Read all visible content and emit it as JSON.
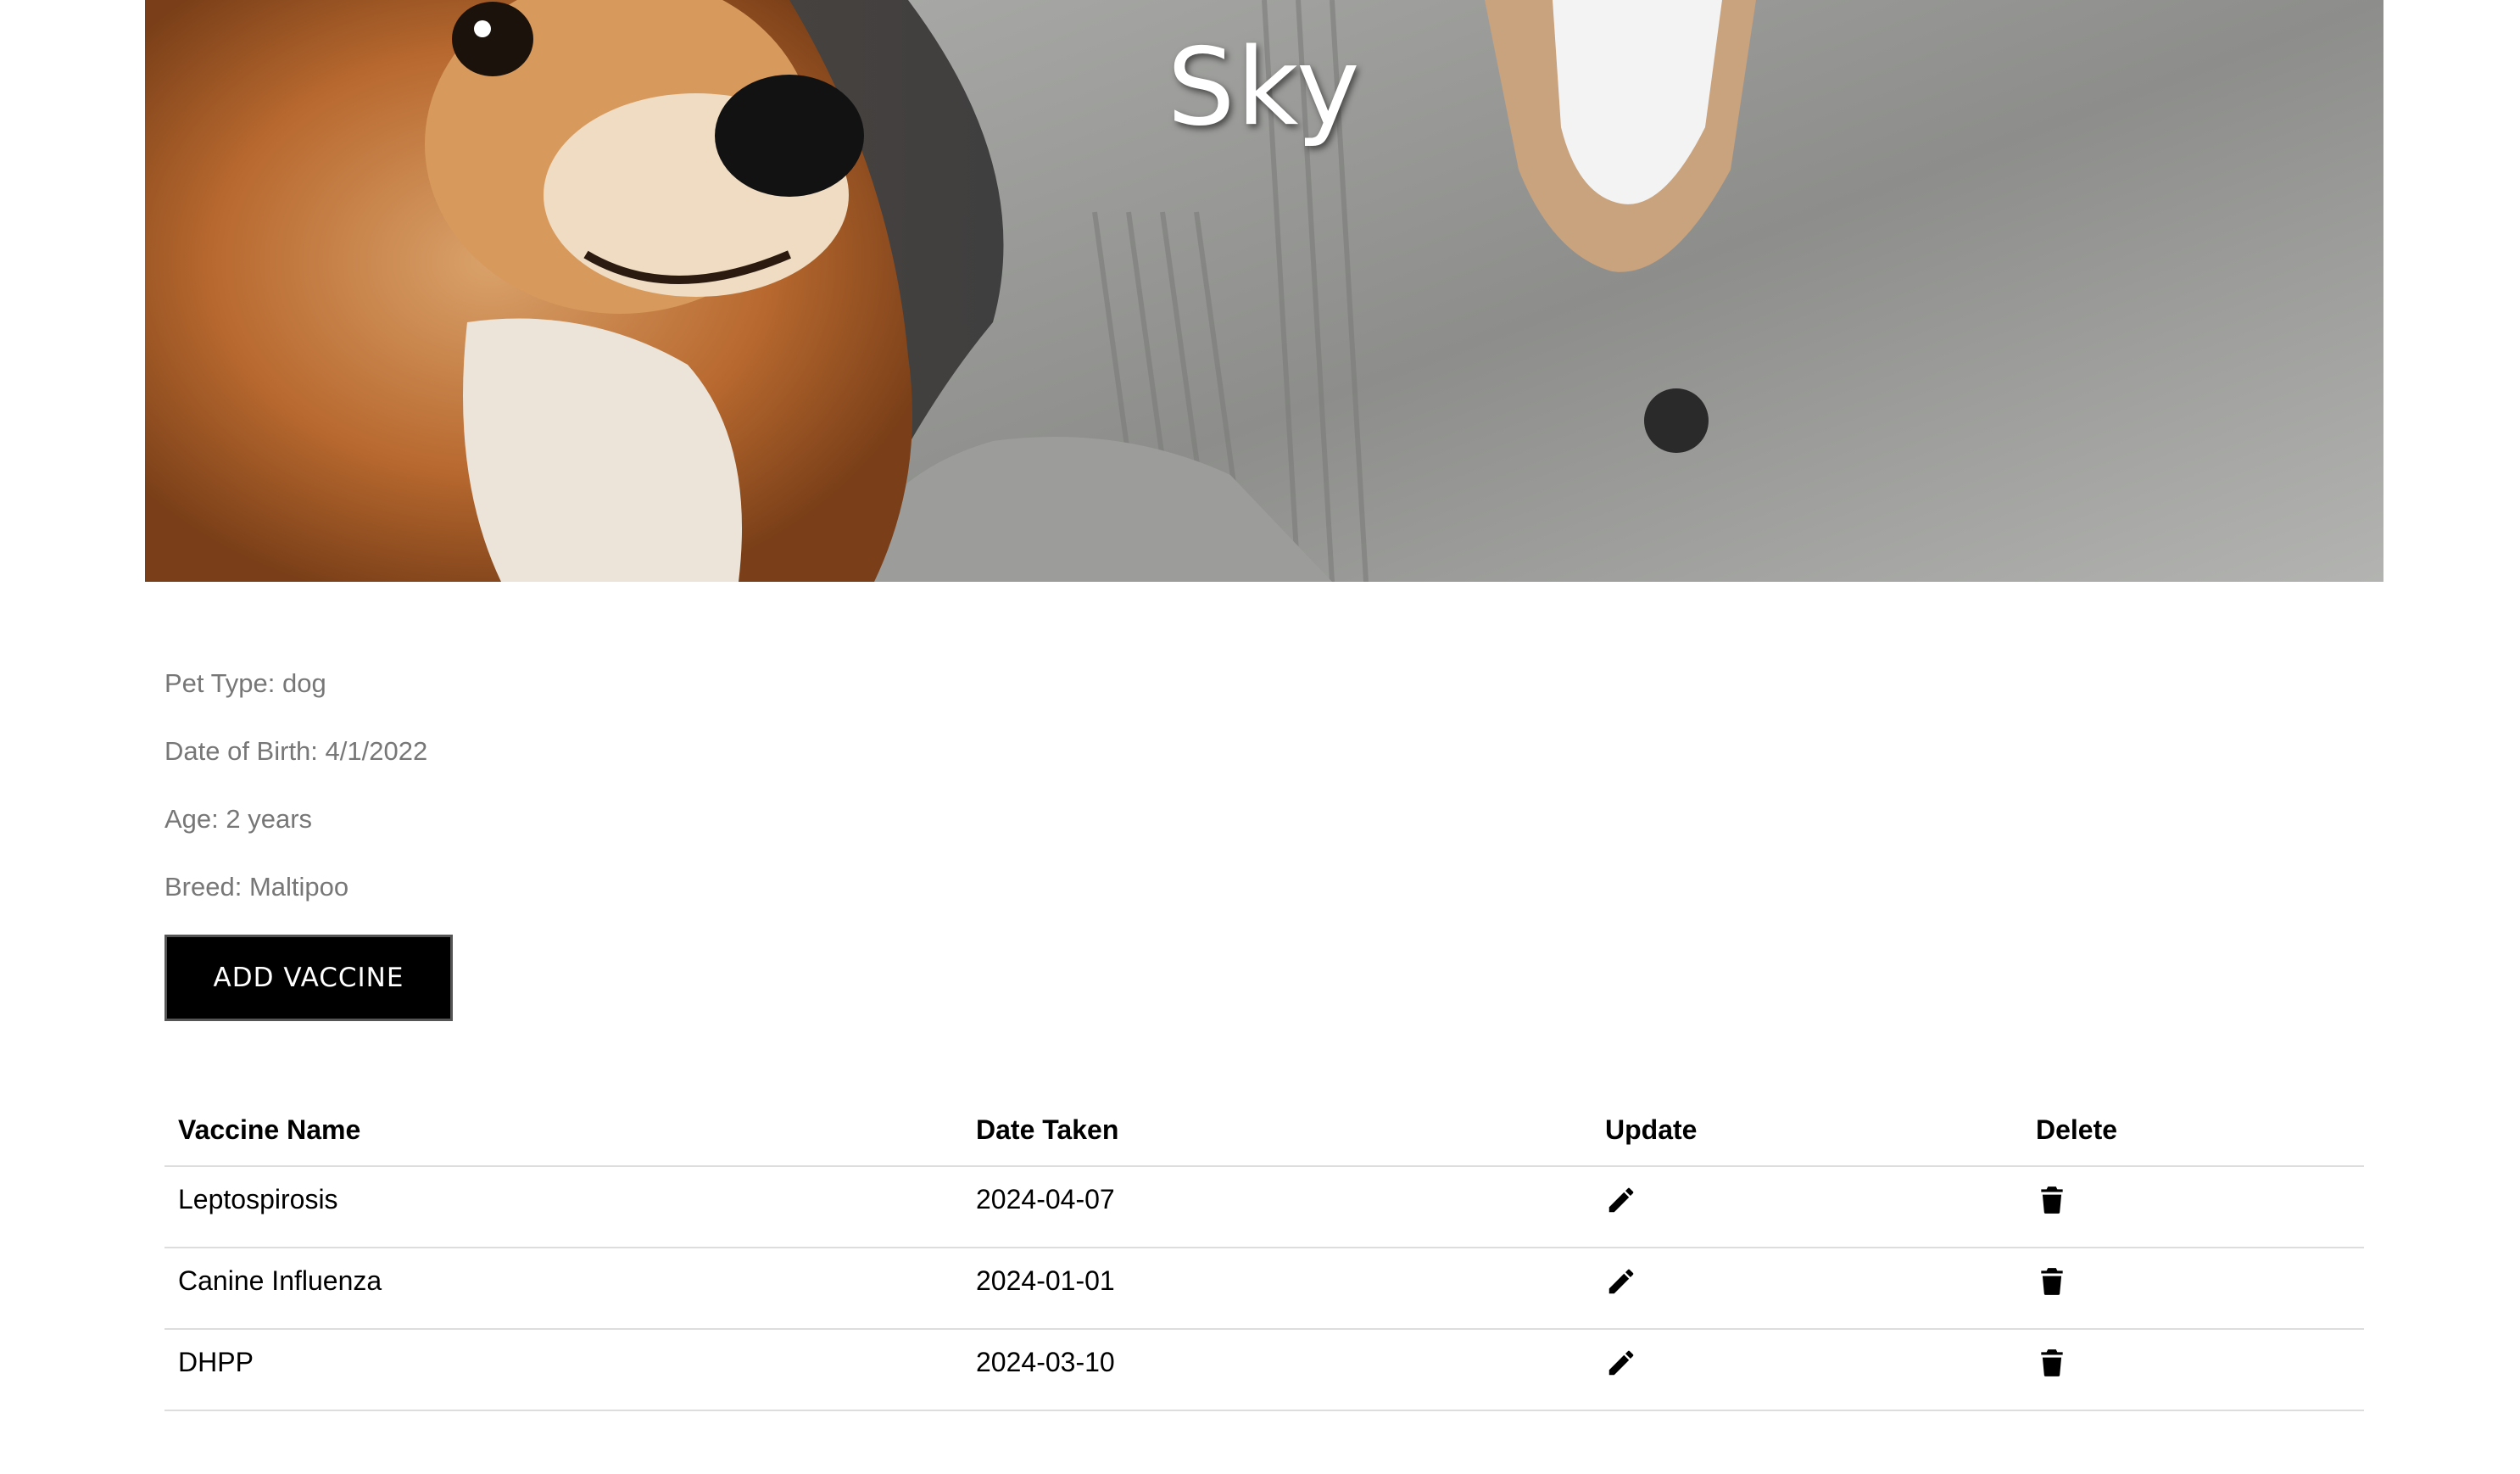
{
  "hero": {
    "pet_name": "Sky"
  },
  "details": {
    "pet_type": "Pet Type: dog",
    "date_of_birth": "Date of Birth: 4/1/2022",
    "age": "Age: 2 years",
    "breed": "Breed: Maltipoo"
  },
  "actions": {
    "add_vaccine_label": "ADD VACCINE"
  },
  "table": {
    "headers": [
      "Vaccine Name",
      "Date Taken",
      "Update",
      "Delete"
    ],
    "rows": [
      {
        "name": "Leptospirosis",
        "date": "2024-04-07",
        "update_icon": "pencil-icon",
        "delete_icon": "trash-icon"
      },
      {
        "name": "Canine Influenza",
        "date": "2024-01-01",
        "update_icon": "pencil-icon",
        "delete_icon": "trash-icon"
      },
      {
        "name": "DHPP",
        "date": "2024-03-10",
        "update_icon": "pencil-icon",
        "delete_icon": "trash-icon"
      }
    ]
  },
  "colors": {
    "button_bg": "#000000",
    "detail_text": "#777777",
    "divider": "#dddddd"
  }
}
